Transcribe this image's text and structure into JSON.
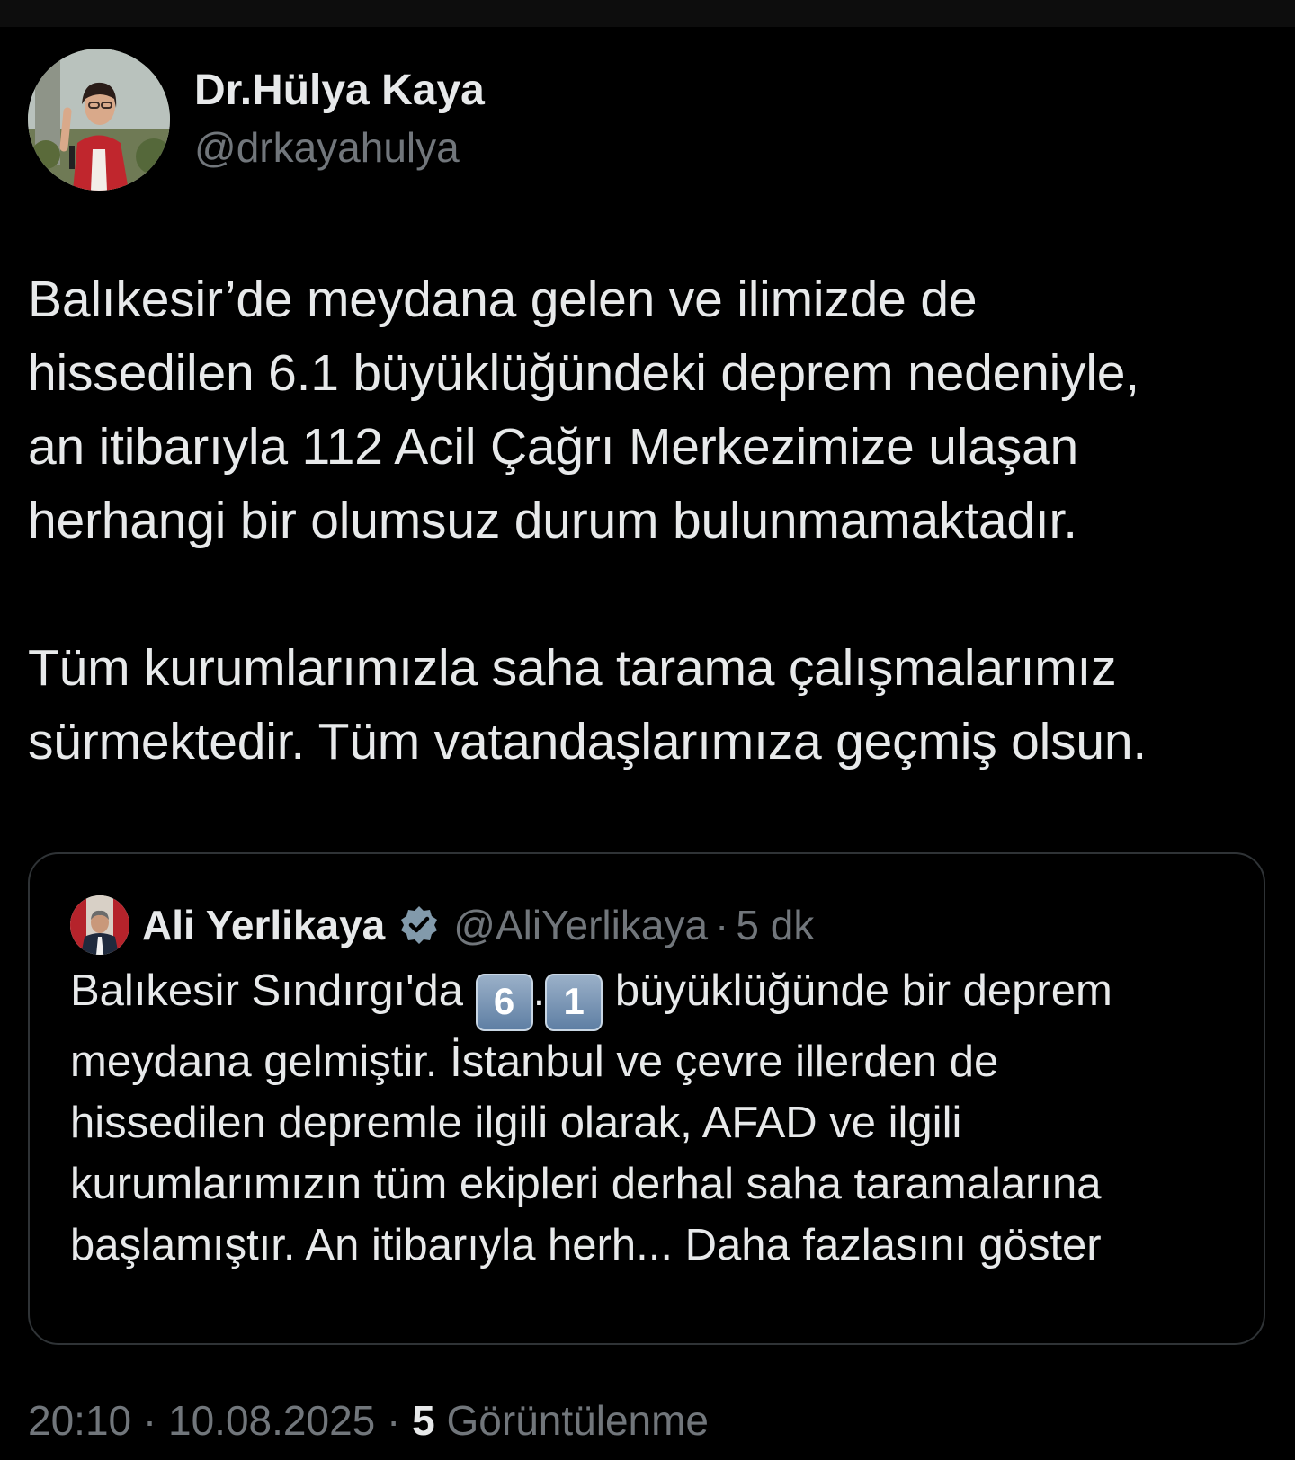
{
  "author": {
    "display_name": "Dr.Hülya Kaya",
    "handle": "@drkayahulya"
  },
  "tweet": {
    "paragraph1": [
      "Balıkesir’de meydana gelen ve ilimizde de",
      "hissedilen 6.1 büyüklüğündeki deprem nedeniyle,",
      "an itibarıyla 112 Acil Çağrı Merkezimize ulaşan",
      "herhangi bir olumsuz durum bulunmamaktadır."
    ],
    "paragraph2": [
      "Tüm kurumlarımızla saha tarama çalışmalarımız",
      "sürmektedir. Tüm vatandaşlarımıza geçmiş olsun."
    ]
  },
  "quote": {
    "display_name": "Ali Yerlikaya",
    "handle": "@AliYerlikaya",
    "separator": "·",
    "time": "5 dk",
    "line1_prefix": "Balıkesir Sındırgı'da ",
    "keycap_1": "6",
    "keycap_dot": ".",
    "keycap_2": "1",
    "line1_suffix": " büyüklüğünde bir deprem",
    "lines": [
      "meydana gelmiştir. İstanbul ve çevre illerden de",
      "hissedilen depremle ilgili olarak, AFAD ve ilgili",
      "kurumlarımızın tüm ekipleri derhal saha taramalarına"
    ],
    "last_line_prefix": "başlamıştır. An itibarıyla herh... ",
    "show_more": "Daha fazlasını göster"
  },
  "meta": {
    "time": "20:10",
    "separator": "·",
    "date": "10.08.2025",
    "views_count": "5",
    "views_label": "Görüntülenme"
  },
  "icons": {
    "verified": "verified-badge-icon"
  },
  "colors": {
    "background": "#000000",
    "text_primary": "#e7e9ea",
    "text_secondary": "#71767b",
    "border": "#2f3336"
  }
}
